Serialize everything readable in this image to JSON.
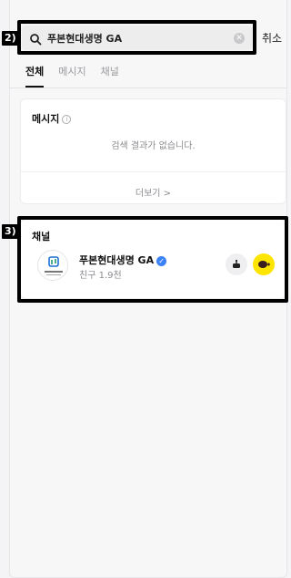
{
  "markers": {
    "search": "2)",
    "channel": "3)"
  },
  "search": {
    "query": "푸본현대생명 GA",
    "cancel_label": "취소"
  },
  "tabs": [
    {
      "label": "전체",
      "active": true
    },
    {
      "label": "메시지",
      "active": false
    },
    {
      "label": "채널",
      "active": false
    }
  ],
  "messages_section": {
    "title": "메시지",
    "empty_text": "검색 결과가 없습니다.",
    "more_label": "더보기 >"
  },
  "channel_section": {
    "title": "채널",
    "channel": {
      "name": "푸본현대생명 GA",
      "friends": "친구 1.9천",
      "verified": true
    }
  },
  "icons": {
    "search": "search-icon",
    "clear": "clear-icon",
    "info": "info-icon",
    "verified": "verified-check-icon",
    "bot": "bot-icon",
    "chat": "chat-plus-icon"
  },
  "colors": {
    "accent_yellow": "#fee500",
    "verified_blue": "#3b82f6",
    "marker": "#000000"
  }
}
